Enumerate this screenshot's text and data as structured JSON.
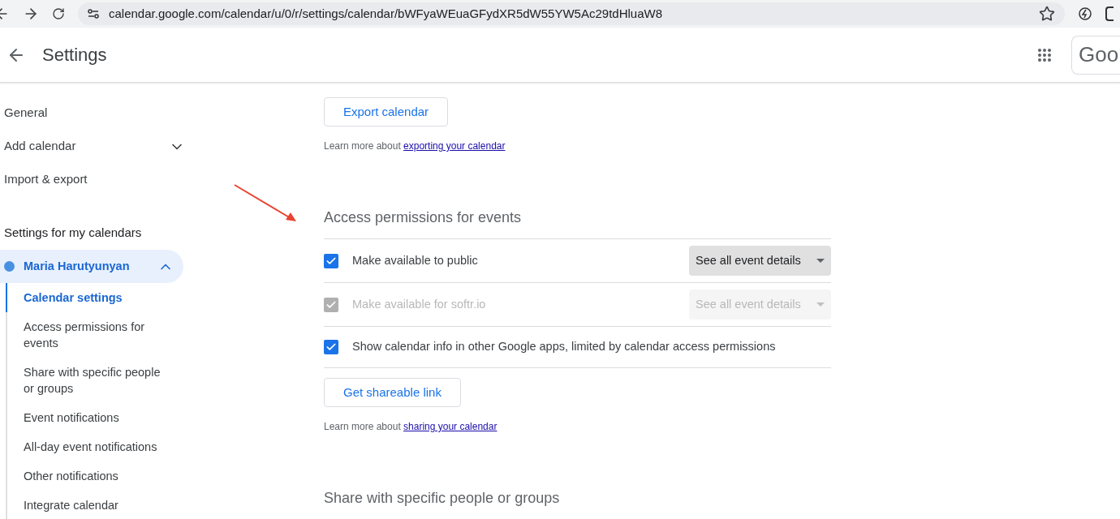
{
  "browser": {
    "url": "calendar.google.com/calendar/u/0/r/settings/calendar/bWFyaWEuaGFydXR5dW55YW5Ac29tdHluaW8"
  },
  "header": {
    "title": "Settings",
    "logo_text": "Goo"
  },
  "sidebar": {
    "items": [
      {
        "label": "General",
        "kind": "link"
      },
      {
        "label": "Add calendar",
        "kind": "expander",
        "expanded": false
      },
      {
        "label": "Import & export",
        "kind": "link"
      }
    ],
    "section_title": "Settings for my calendars",
    "calendars": [
      {
        "name": "Maria Harutyunyan",
        "color": "#4a90e2",
        "expanded": true,
        "children": [
          {
            "label": "Calendar settings",
            "selected": true
          },
          {
            "label": "Access permissions for events",
            "selected": false
          },
          {
            "label": "Share with specific people or groups",
            "selected": false
          },
          {
            "label": "Event notifications",
            "selected": false
          },
          {
            "label": "All-day event notifications",
            "selected": false
          },
          {
            "label": "Other notifications",
            "selected": false
          },
          {
            "label": "Integrate calendar",
            "selected": false
          }
        ]
      }
    ]
  },
  "export": {
    "button": "Export calendar",
    "note": "Learn more about ",
    "link": "exporting your calendar"
  },
  "access": {
    "title": "Access permissions for events",
    "rows": [
      {
        "label": "Make available to public",
        "checked": true,
        "disabled": false,
        "dropdown": "See all event details"
      },
      {
        "label": "Make available for softr.io",
        "checked": true,
        "disabled": true,
        "dropdown": "See all event details"
      },
      {
        "label": "Show calendar info in other Google apps, limited by calendar access permissions",
        "checked": true,
        "disabled": false
      }
    ],
    "button": "Get shareable link",
    "note": "Learn more about ",
    "link": "sharing your calendar"
  },
  "next_section": {
    "title": "Share with specific people or groups"
  }
}
